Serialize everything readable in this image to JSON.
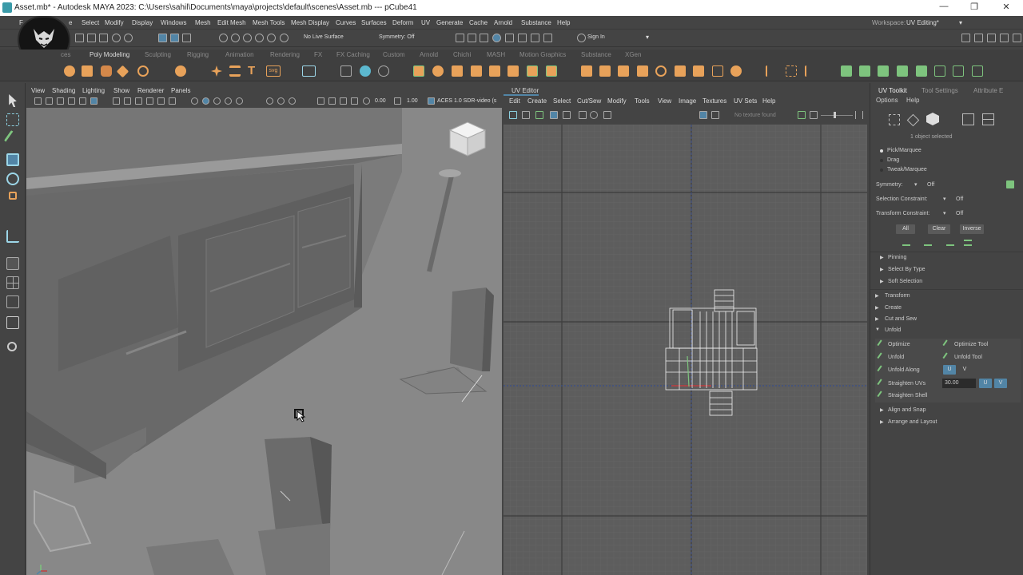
{
  "titlebar": {
    "title": "Asset.mb* - Autodesk MAYA 2023: C:\\Users\\sahil\\Documents\\maya\\projects\\default\\scenes\\Asset.mb  ---  pCube41",
    "minimize": "—",
    "maximize": "❐",
    "close": "✕"
  },
  "menubar": {
    "items": [
      "F",
      "e",
      "Select",
      "Modify",
      "Display",
      "Windows",
      "Mesh",
      "Edit Mesh",
      "Mesh Tools",
      "Mesh Display",
      "Curves",
      "Surfaces",
      "Deform",
      "UV",
      "Generate",
      "Cache",
      "Arnold",
      "Substance",
      "Help"
    ],
    "workspace_label": "Workspace:",
    "workspace_value": "UV Editing*"
  },
  "statusline": {
    "live_surface": "No Live Surface",
    "symmetry": "Symmetry: Off",
    "sign_in": "Sign In"
  },
  "shelf": {
    "tabs": [
      "ces",
      "Poly Modeling",
      "Sculpting",
      "Rigging",
      "Animation",
      "Rendering",
      "FX",
      "FX Caching",
      "Custom",
      "Arnold",
      "Chichi",
      "MASH",
      "Motion Graphics",
      "Substance",
      "XGen"
    ],
    "active_tab": "Poly Modeling",
    "svg_label": "svg"
  },
  "viewport": {
    "menus": [
      "View",
      "Shading",
      "Lighting",
      "Show",
      "Renderer",
      "Panels"
    ],
    "exposure": "0.00",
    "gamma": "1.00",
    "colorspace": "ACES 1.0 SDR-video (s"
  },
  "uv_editor": {
    "title": "UV Editor",
    "menus": [
      "Edit",
      "Create",
      "Select",
      "Cut/Sew",
      "Modify",
      "Tools",
      "View",
      "Image",
      "Textures",
      "UV Sets",
      "Help"
    ],
    "texture_status": "No texture found"
  },
  "toolkit": {
    "tabs": [
      "UV Toolkit",
      "Tool Settings",
      "Attribute E"
    ],
    "menus": [
      "Options",
      "Help"
    ],
    "selection_info": "1 object selected",
    "modes": [
      "Pick/Marquee",
      "Drag",
      "Tweak/Marquee"
    ],
    "symmetry_label": "Symmetry:",
    "symmetry_value": "Off",
    "sel_constraint_label": "Selection Constraint:",
    "sel_constraint_value": "Off",
    "xform_constraint_label": "Transform Constraint:",
    "xform_constraint_value": "Off",
    "btn_all": "All",
    "btn_clear": "Clear",
    "btn_inverse": "Inverse",
    "sections_top": [
      "Pinning",
      "Select By Type",
      "Soft Selection"
    ],
    "sections_mid": [
      "Transform",
      "Create",
      "Cut and Sew",
      "Unfold"
    ],
    "unfold": {
      "optimize": "Optimize",
      "optimize_tool": "Optimize Tool",
      "unfold": "Unfold",
      "unfold_tool": "Unfold Tool",
      "unfold_along": "Unfold Along",
      "u": "U",
      "v": "V",
      "straighten_uvs": "Straighten UVs",
      "straighten_value": "30.00",
      "straighten_shell": "Straighten Shell"
    },
    "sections_bottom": [
      "Align and Snap",
      "Arrange and Layout"
    ]
  },
  "colors": {
    "accent_blue": "#5285a6",
    "shelf_orange": "#e8a25a",
    "selection_green": "#7ec47e",
    "axis_red": "#c04040"
  }
}
